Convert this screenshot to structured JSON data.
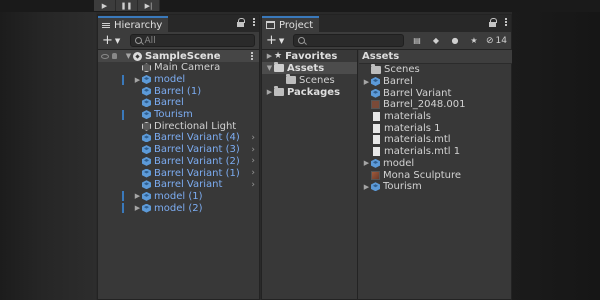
{
  "play_controls": [
    {
      "icon": "play-icon",
      "glyph": "▶"
    },
    {
      "icon": "pause-icon",
      "glyph": "❚❚"
    },
    {
      "icon": "step-icon",
      "glyph": "▶|"
    }
  ],
  "hierarchy": {
    "tab_label": "Hierarchy",
    "search_placeholder": "All",
    "add_symbol": "+",
    "scene_name": "SampleScene",
    "items": [
      {
        "label": "Main Camera",
        "type": "plain",
        "prefab": false,
        "expandable": false,
        "selected": false
      },
      {
        "label": "model",
        "type": "prefab",
        "prefab": true,
        "expandable": true,
        "selected": true
      },
      {
        "label": "Barrel (1)",
        "type": "prefab",
        "prefab": true,
        "expandable": false,
        "selected": false
      },
      {
        "label": "Barrel",
        "type": "prefab",
        "prefab": true,
        "expandable": false,
        "selected": false
      },
      {
        "label": "Tourism",
        "type": "prefab",
        "prefab": true,
        "expandable": false,
        "selected": true
      },
      {
        "label": "Directional Light",
        "type": "plain",
        "prefab": false,
        "expandable": false,
        "selected": false
      },
      {
        "label": "Barrel Variant (4)",
        "type": "prefab",
        "prefab": true,
        "expandable": false,
        "selected": false,
        "has_arrow": true
      },
      {
        "label": "Barrel Variant (3)",
        "type": "prefab",
        "prefab": true,
        "expandable": false,
        "selected": false,
        "has_arrow": true
      },
      {
        "label": "Barrel Variant (2)",
        "type": "prefab",
        "prefab": true,
        "expandable": false,
        "selected": false,
        "has_arrow": true
      },
      {
        "label": "Barrel Variant (1)",
        "type": "prefab",
        "prefab": true,
        "expandable": false,
        "selected": false,
        "has_arrow": true
      },
      {
        "label": "Barrel Variant",
        "type": "prefab",
        "prefab": true,
        "expandable": false,
        "selected": false,
        "has_arrow": true
      },
      {
        "label": "model (1)",
        "type": "prefab",
        "prefab": true,
        "expandable": true,
        "selected": true
      },
      {
        "label": "model (2)",
        "type": "prefab",
        "prefab": true,
        "expandable": true,
        "selected": true
      }
    ]
  },
  "project": {
    "tab_label": "Project",
    "add_symbol": "+",
    "hidden_count": "14",
    "tree": [
      {
        "label": "Favorites",
        "icon": "star",
        "indent": 0,
        "bold": true,
        "expandable": true,
        "selected": false
      },
      {
        "label": "Assets",
        "icon": "folder-open",
        "indent": 0,
        "bold": true,
        "expandable": true,
        "selected": true
      },
      {
        "label": "Scenes",
        "icon": "folder",
        "indent": 1,
        "bold": false,
        "expandable": false,
        "selected": false
      },
      {
        "label": "Packages",
        "icon": "folder",
        "indent": 0,
        "bold": true,
        "expandable": true,
        "selected": false
      }
    ],
    "assets_header": "Assets",
    "assets": [
      {
        "label": "Scenes",
        "icon": "folder",
        "expandable": false
      },
      {
        "label": "Barrel",
        "icon": "prefab",
        "expandable": true
      },
      {
        "label": "Barrel Variant",
        "icon": "prefab",
        "expandable": false
      },
      {
        "label": "Barrel_2048.001",
        "icon": "texture",
        "expandable": false
      },
      {
        "label": "materials",
        "icon": "document",
        "expandable": false
      },
      {
        "label": "materials 1",
        "icon": "document",
        "expandable": false
      },
      {
        "label": "materials.mtl",
        "icon": "document",
        "expandable": false
      },
      {
        "label": "materials.mtl 1",
        "icon": "document",
        "expandable": false
      },
      {
        "label": "model",
        "icon": "prefab",
        "expandable": true
      },
      {
        "label": "Mona Sculpture",
        "icon": "texture-sculpture",
        "expandable": false
      },
      {
        "label": "Tourism",
        "icon": "prefab",
        "expandable": true
      }
    ]
  },
  "colors": {
    "accent": "#3a79bb",
    "prefab_text": "#7cacf1",
    "panel_bg": "#383838"
  }
}
